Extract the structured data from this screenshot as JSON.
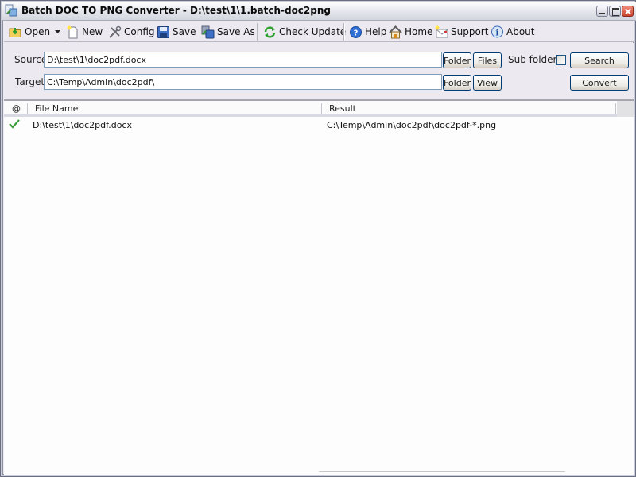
{
  "window": {
    "title": "Batch DOC TO PNG Converter - D:\\test\\1\\1.batch-doc2png",
    "app_icon": "app-icon",
    "controls": [
      "minimize",
      "maximize",
      "close"
    ]
  },
  "toolbar": {
    "items": [
      {
        "id": "open",
        "label": "Open",
        "icon": "open-folder-icon",
        "accel": "O"
      },
      {
        "id": "new",
        "label": "New",
        "icon": "new-file-icon",
        "accel": "N"
      },
      {
        "id": "config",
        "label": "Config",
        "icon": "tools-icon"
      },
      {
        "id": "save",
        "label": "Save",
        "icon": "floppy-icon",
        "accel": "v"
      },
      {
        "id": "save_as",
        "label": "Save As",
        "icon": "save-as-icon",
        "accel": "A"
      },
      {
        "id": "check_update",
        "label": "Check Update",
        "icon": "refresh-icon",
        "accel": "U"
      },
      {
        "id": "help",
        "label": "Help",
        "icon": "help-icon",
        "accel": "H"
      },
      {
        "id": "home",
        "label": "Home",
        "icon": "home-icon"
      },
      {
        "id": "support",
        "label": "Support",
        "icon": "mail-icon"
      },
      {
        "id": "about",
        "label": "About",
        "icon": "info-icon"
      }
    ]
  },
  "form": {
    "source_label": "Source",
    "source_value": "D:\\test\\1\\doc2pdf.docx",
    "target_label": "Target",
    "target_value": "C:\\Temp\\Admin\\doc2pdf\\",
    "folder_button": "Folder",
    "files_button": "Files",
    "view_button": "View",
    "subfolders_label": "Sub folders",
    "subfolders_checked": false,
    "search_button": "Search",
    "convert_button": "Convert"
  },
  "list": {
    "columns": [
      "@",
      "File Name",
      "Result"
    ],
    "rows": [
      {
        "status": "success",
        "file_name": "D:\\test\\1\\doc2pdf.docx",
        "result": "C:\\Temp\\Admin\\doc2pdf\\doc2pdf-*.png"
      }
    ]
  }
}
